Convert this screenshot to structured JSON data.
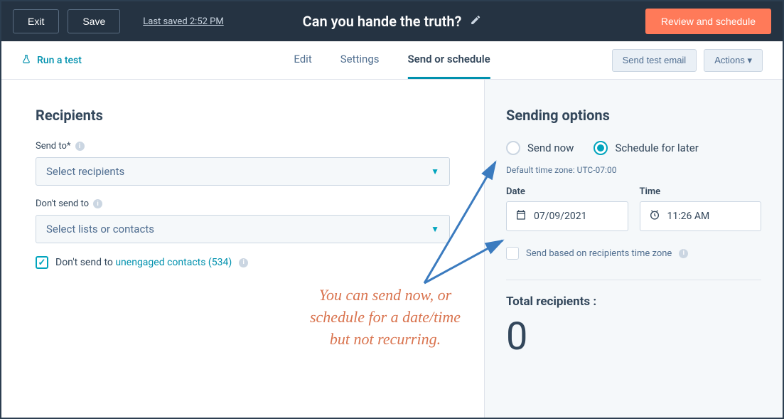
{
  "topbar": {
    "exit": "Exit",
    "save": "Save",
    "last_saved": "Last saved 2:52 PM",
    "title": "Can you hande the truth?",
    "review": "Review and schedule"
  },
  "subbar": {
    "run_test": "Run a test",
    "tabs": {
      "edit": "Edit",
      "settings": "Settings",
      "schedule": "Send or schedule"
    },
    "send_test": "Send test email",
    "actions": "Actions"
  },
  "recipients": {
    "heading": "Recipients",
    "send_to_label": "Send to*",
    "send_to_placeholder": "Select recipients",
    "dont_send_label": "Don't send to",
    "dont_send_placeholder": "Select lists or contacts",
    "unengaged_prefix": "Don't send to ",
    "unengaged_link": "unengaged contacts (534)"
  },
  "sending": {
    "heading": "Sending options",
    "send_now": "Send now",
    "schedule_later": "Schedule for later",
    "tz_note": "Default time zone: UTC-07:00",
    "date_label": "Date",
    "date_value": "07/09/2021",
    "time_label": "Time",
    "time_value": "11:26 AM",
    "tz_checkbox_label": "Send based on recipients time zone",
    "total_label": "Total recipients :",
    "total_value": "0"
  },
  "annotation": {
    "text": "You can send now, or schedule for a date/time but not recurring."
  }
}
